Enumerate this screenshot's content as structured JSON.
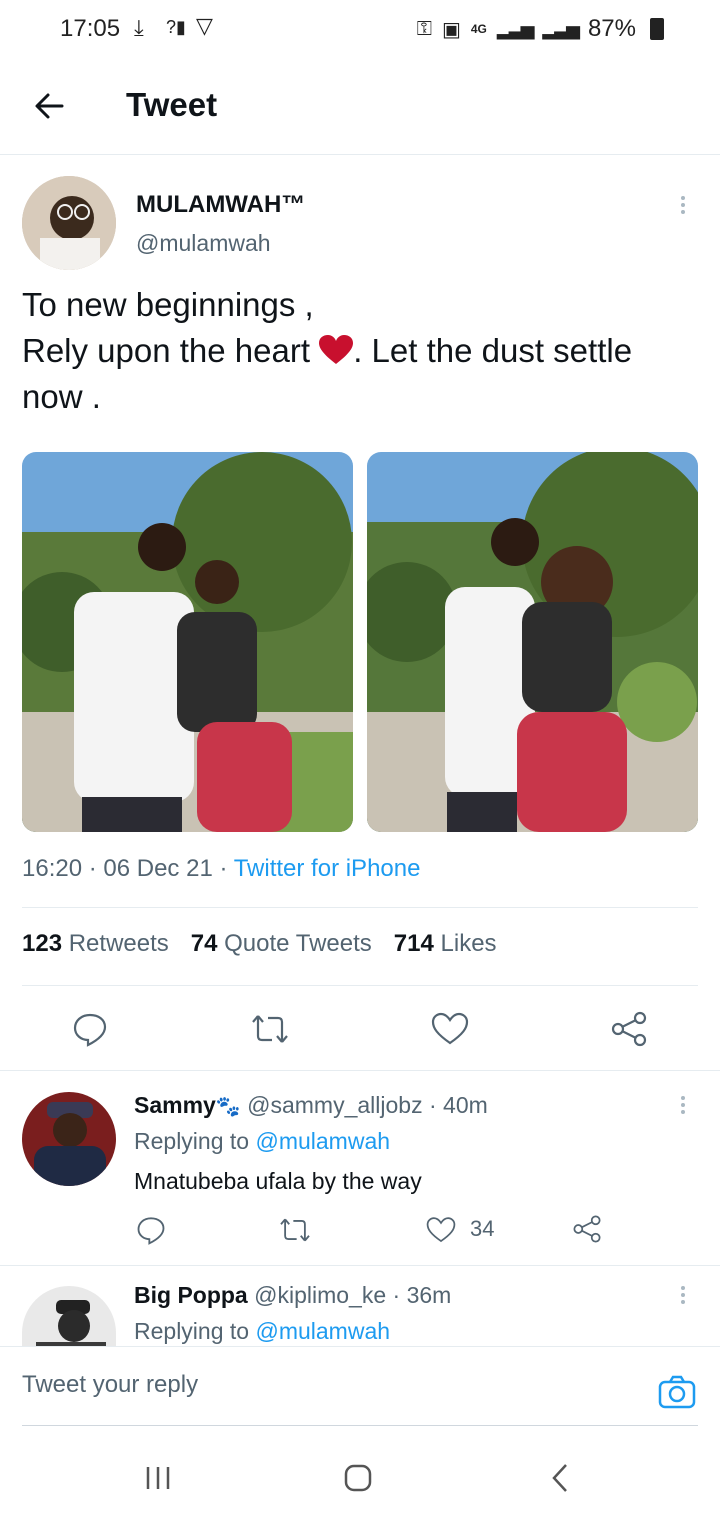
{
  "status_bar": {
    "time": "17:05",
    "battery": "87%",
    "network": "4G"
  },
  "header": {
    "title": "Tweet"
  },
  "tweet": {
    "author_name": "MULAMWAH™",
    "author_handle": "@mulamwah",
    "text_line1": "To new beginnings ,",
    "text_line2_a": "Rely upon the heart",
    "text_line2_b": ". Let the dust settle",
    "text_line3": "now .",
    "time": "16:20",
    "date": "06 Dec 21",
    "source": "Twitter for iPhone",
    "retweets_count": "123",
    "retweets_label": "Retweets",
    "quotes_count": "74",
    "quotes_label": "Quote Tweets",
    "likes_count": "714",
    "likes_label": "Likes"
  },
  "replies": [
    {
      "name": "Sammy",
      "handle": "@sammy_alljobz",
      "age": "· 40m",
      "replying_prefix": "Replying to",
      "replying_to": "@mulamwah",
      "text": "Mnatubeba ufala by the way",
      "likes": "34"
    },
    {
      "name": "Big Poppa",
      "handle": "@kiplimo_ke",
      "age": "· 36m",
      "replying_prefix": "Replying to",
      "replying_to": "@mulamwah"
    }
  ],
  "composer": {
    "placeholder": "Tweet your reply"
  },
  "colors": {
    "accent": "#1d9bf0",
    "text": "#0f1419",
    "muted": "#536471",
    "heart": "#e0245e"
  }
}
